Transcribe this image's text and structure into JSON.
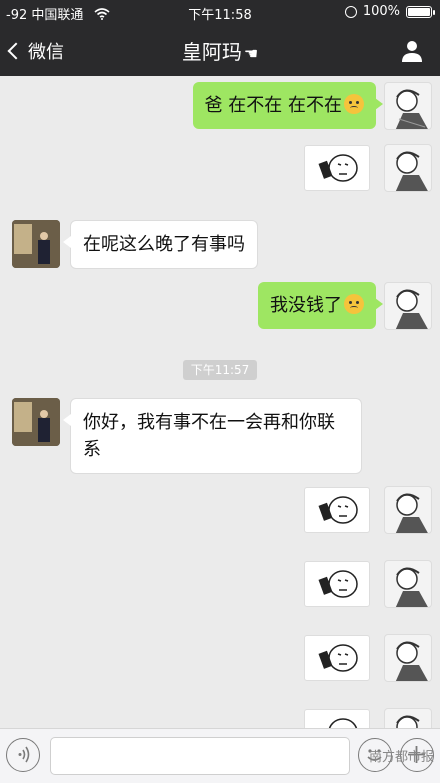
{
  "status": {
    "signal": "-92",
    "carrier": "中国联通",
    "time": "下午11:58",
    "battery": "100%"
  },
  "nav": {
    "back_label": "微信",
    "title": "皇阿玛"
  },
  "messages": [
    {
      "side": "right",
      "type": "text",
      "text": "爸 在不在 在不在"
    },
    {
      "side": "right",
      "type": "sticker"
    },
    {
      "side": "left",
      "type": "text",
      "text": "在呢这么晚了有事吗"
    },
    {
      "side": "right",
      "type": "text",
      "text": "我没钱了"
    },
    {
      "side": "left",
      "type": "text",
      "text": "你好，我有事不在一会再和你联系"
    },
    {
      "side": "right",
      "type": "sticker"
    },
    {
      "side": "right",
      "type": "sticker"
    },
    {
      "side": "right",
      "type": "sticker"
    },
    {
      "side": "right",
      "type": "sticker"
    }
  ],
  "timestamp": "下午11:57",
  "watermark": "南方都市报",
  "colors": {
    "nav_bg": "#2a2a2c",
    "chat_bg": "#ebebeb",
    "green_bubble": "#9ee662"
  }
}
